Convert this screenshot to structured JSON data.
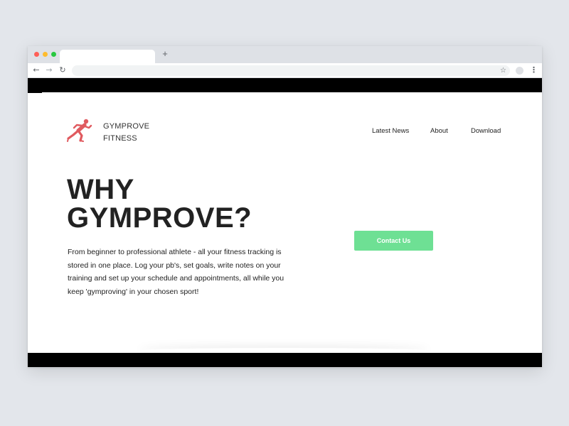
{
  "browser": {
    "new_tab_glyph": "+",
    "back_glyph": "←",
    "forward_glyph": "→",
    "reload_glyph": "↻",
    "bookmark_glyph": "☆",
    "menu_glyph": "⋮",
    "traffic_light_colors": [
      "#fe5f57",
      "#febc2e",
      "#28c840"
    ]
  },
  "header": {
    "logo_icon": "sprinter-icon",
    "logo_color": "#e05a5f",
    "brand_line1": "GYMPROVE",
    "brand_line2": "FITNESS"
  },
  "nav": {
    "items": [
      {
        "label": "Latest News"
      },
      {
        "label": "About"
      },
      {
        "label": "Download"
      }
    ]
  },
  "hero": {
    "headline_line1": "WHY",
    "headline_line2": "GYMPROVE?",
    "description": "From beginner to professional athlete - all your fitness tracking is stored in one place. Log your pb's, set goals, write notes on your training and set up your schedule and appointments, all while you keep 'gymproving' in your chosen sport!",
    "cta_label": "Contact Us",
    "cta_color": "#6ee094"
  }
}
